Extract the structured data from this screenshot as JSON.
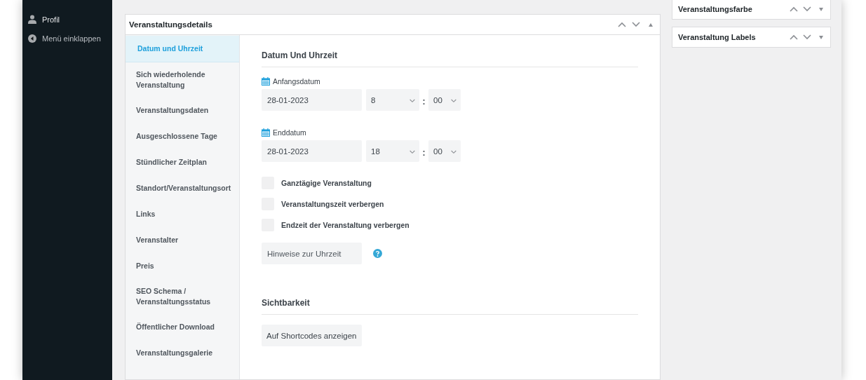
{
  "admin_menu": [
    {
      "kind": "profile",
      "label": "Profil"
    },
    {
      "kind": "collapse",
      "label": "Menü einklappen"
    }
  ],
  "panel": {
    "title": "Veranstaltungsdetails",
    "tabs": [
      {
        "label": "Datum und Uhrzeit",
        "selected": true
      },
      {
        "label": "Sich wiederholende Veranstaltung",
        "selected": false
      },
      {
        "label": "Veranstaltungsdaten",
        "selected": false
      },
      {
        "label": "Ausgeschlossene Tage",
        "selected": false
      },
      {
        "label": "Stündlicher Zeitplan",
        "selected": false
      },
      {
        "label": "Standort/Veranstaltungsort",
        "selected": false
      },
      {
        "label": "Links",
        "selected": false
      },
      {
        "label": "Veranstalter",
        "selected": false
      },
      {
        "label": "Preis",
        "selected": false
      },
      {
        "label": "SEO Schema / Veranstaltungsstatus",
        "selected": false
      },
      {
        "label": "Öffentlicher Download",
        "selected": false
      },
      {
        "label": "Veranstaltungsgalerie",
        "selected": false
      }
    ],
    "date_section": {
      "heading": "Datum Und Uhrzeit",
      "dates": [
        {
          "label": "Anfangsdatum",
          "date": "28-01-2023",
          "hour": "8",
          "separator": ":",
          "minute": "00"
        },
        {
          "label": "Enddatum",
          "date": "28-01-2023",
          "hour": "18",
          "separator": ":",
          "minute": "00"
        }
      ],
      "options": [
        {
          "label": "Ganztägige Veranstaltung",
          "checked": false
        },
        {
          "label": "Veranstaltungszeit verbergen",
          "checked": false
        },
        {
          "label": "Endzeit der Veranstaltung verbergen",
          "checked": false
        }
      ],
      "notes": {
        "placeholder": "Hinweise zur Uhrzeit"
      }
    },
    "visibility": {
      "heading": "Sichtbarkeit",
      "button": "Auf Shortcodes anzeigen"
    }
  },
  "side_boxes": [
    {
      "title": "Veranstaltungsfarbe"
    },
    {
      "title": "Veranstaltung Labels"
    }
  ]
}
